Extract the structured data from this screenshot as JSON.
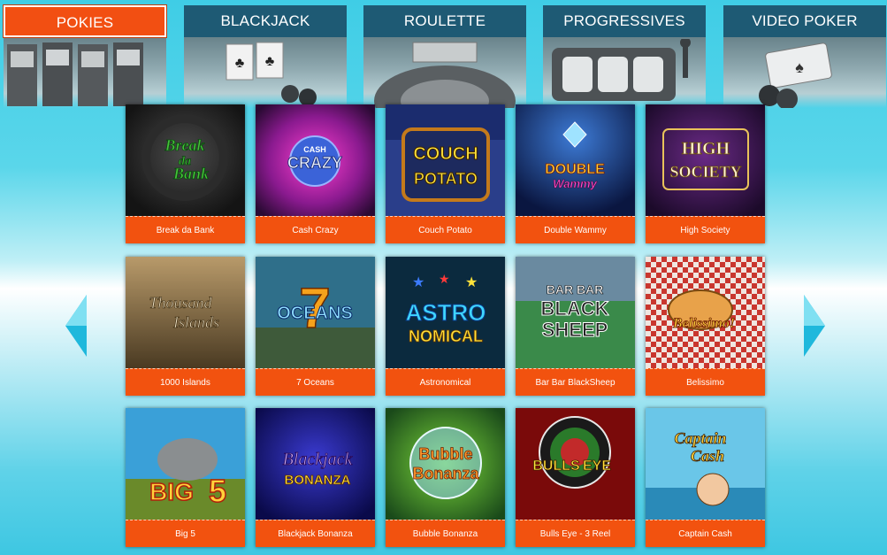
{
  "tabs": [
    {
      "label": "POKIES",
      "active": true
    },
    {
      "label": "BLACKJACK",
      "active": false
    },
    {
      "label": "ROULETTE",
      "active": false
    },
    {
      "label": "PROGRESSIVES",
      "active": false
    },
    {
      "label": "VIDEO POKER",
      "active": false
    }
  ],
  "games": [
    {
      "name": "Break da Bank",
      "art": [
        "Break",
        "da",
        "Bank"
      ]
    },
    {
      "name": "Cash Crazy",
      "art": [
        "CASH",
        "CRAZY"
      ]
    },
    {
      "name": "Couch Potato",
      "art": [
        "COUCH",
        "POTATO"
      ]
    },
    {
      "name": "Double Wammy",
      "art": [
        "DOUBLE",
        "Wammy"
      ]
    },
    {
      "name": "High Society",
      "art": [
        "HIGH",
        "SOCIETY"
      ]
    },
    {
      "name": "1000 Islands",
      "art": [
        "Thousand",
        "Islands"
      ]
    },
    {
      "name": "7 Oceans",
      "art": [
        "7",
        "OCEANS"
      ]
    },
    {
      "name": "Astronomical",
      "art": [
        "ASTRO",
        "NOMICAL"
      ]
    },
    {
      "name": "Bar Bar BlackSheep",
      "art": [
        "BAR BAR",
        "BLACK",
        "SHEEP"
      ]
    },
    {
      "name": "Belissimo",
      "art": [
        "Belissimo!"
      ]
    },
    {
      "name": "Big 5",
      "art": [
        "BIG",
        "5"
      ]
    },
    {
      "name": "Blackjack Bonanza",
      "art": [
        "Blackjack",
        "BONANZA"
      ]
    },
    {
      "name": "Bubble Bonanza",
      "art": [
        "Bubble",
        "Bonanza"
      ]
    },
    {
      "name": "Bulls Eye - 3 Reel",
      "art": [
        "BULLS",
        "EYE"
      ]
    },
    {
      "name": "Captain Cash",
      "art": [
        "Captain",
        "Cash"
      ]
    }
  ],
  "nav": {
    "prev": "previous-page",
    "next": "next-page"
  },
  "colors": {
    "accent": "#f2520f",
    "tab": "#1e5a74",
    "arrow": "#1fb8dc"
  }
}
